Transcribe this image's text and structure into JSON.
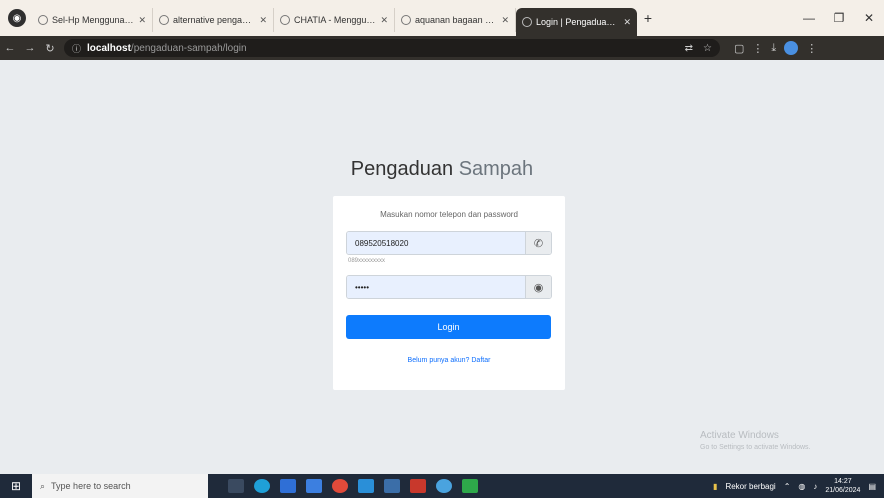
{
  "browser": {
    "tabs": [
      {
        "title": "Sel-Hp Menggunakan Fi"
      },
      {
        "title": "alternative pengaduan s"
      },
      {
        "title": "CHATIA - Menggunakan fo"
      },
      {
        "title": "aquanan bagaan penga"
      },
      {
        "title": "Login | Pengaduan Sampah"
      }
    ],
    "active_tab": 4,
    "new_tab_label": "+",
    "url_host": "localhost",
    "url_path": "/pengaduan-sampah/login"
  },
  "page": {
    "brand_bold": "Pengaduan",
    "brand_light": "Sampah",
    "card_message": "Masukan nomor telepon dan password",
    "phone_value": "089520518020",
    "hint_text": "089xxxxxxxxx",
    "password_value": "•••••",
    "login_label": "Login",
    "register_link": "Belum punya akun? Daftar",
    "watermark_line1": "Activate Windows",
    "watermark_line2": "Go to Settings to activate Windows."
  },
  "taskbar": {
    "search_placeholder": "Type here to search",
    "weather": "Rekor berbagi",
    "time": "14:27",
    "date": "21/06/2024"
  },
  "icons": {
    "phone": "phone-icon",
    "eye": "eye-icon"
  },
  "colors": {
    "primary": "#0d7bfd",
    "tab_active": "#33302c",
    "taskbar": "#1f2a3a"
  }
}
